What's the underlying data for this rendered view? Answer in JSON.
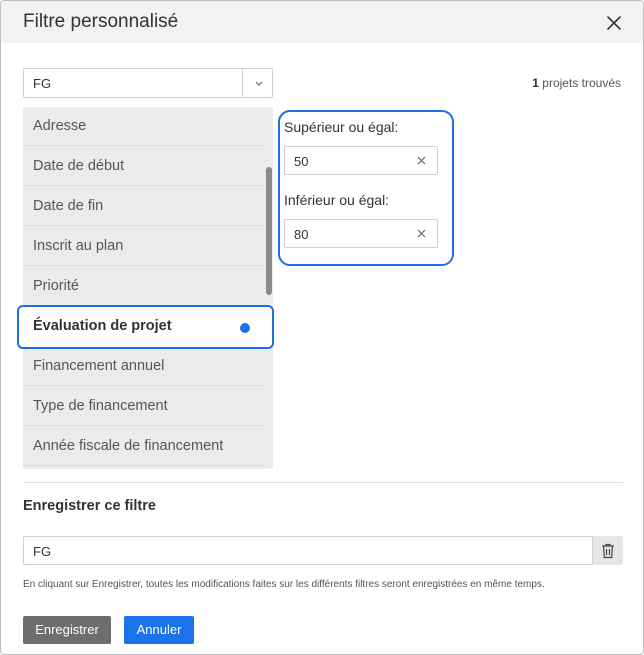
{
  "dialog": {
    "title": "Filtre personnalisé"
  },
  "filter_select": {
    "value": "FG"
  },
  "result": {
    "count": "1",
    "suffix": "projets trouvés"
  },
  "fields": [
    {
      "label": "Adresse"
    },
    {
      "label": "Date de début"
    },
    {
      "label": "Date de fin"
    },
    {
      "label": "Inscrit au plan"
    },
    {
      "label": "Priorité"
    },
    {
      "label": "Évaluation de projet",
      "selected": true
    },
    {
      "label": "Financement annuel"
    },
    {
      "label": "Type de financement"
    },
    {
      "label": "Année fiscale de financement"
    }
  ],
  "range": {
    "min_label": "Supérieur ou égal:",
    "min_value": "50",
    "max_label": "Inférieur ou égal:",
    "max_value": "80"
  },
  "save_section": {
    "heading": "Enregistrer ce filtre",
    "name_value": "FG",
    "note": "En cliquant sur Enregistrer, toutes les modifications faites sur les différents filtres seront enregistrées en même temps.",
    "save_label": "Enregistrer",
    "cancel_label": "Annuler"
  },
  "colors": {
    "accent": "#1f6ee8",
    "save_button": "#6d6d6d",
    "cancel_button": "#1a73e8",
    "list_background": "#ebebeb",
    "header_background": "#f2f2f2"
  },
  "icons": {
    "close": "close-icon",
    "chevron": "chevron-down-icon",
    "clear": "clear-icon",
    "trash": "trash-icon"
  }
}
